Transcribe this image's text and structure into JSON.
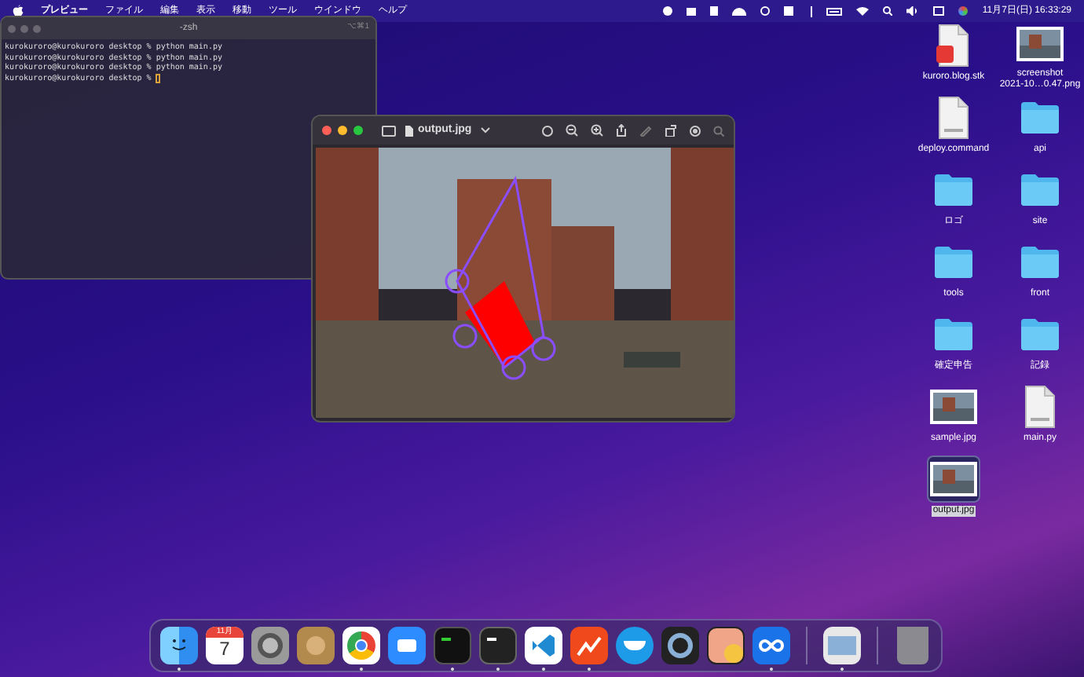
{
  "menu_bar": {
    "app_name": "プレビュー",
    "menus": [
      "ファイル",
      "編集",
      "表示",
      "移動",
      "ツール",
      "ウインドウ",
      "ヘルプ"
    ],
    "clock": "11月7日(日) 16:33:29"
  },
  "terminal": {
    "title": "-zsh",
    "shortcut": "⌥⌘1",
    "lines": [
      "kurokuroro@kurokuroro desktop % python main.py",
      "kurokuroro@kurokuroro desktop % python main.py",
      "kurokuroro@kurokuroro desktop % python main.py",
      "kurokuroro@kurokuroro desktop % "
    ]
  },
  "preview": {
    "title": "output.jpg"
  },
  "desktop_icons": [
    {
      "kind": "document",
      "label": "kuroro.blog.stk",
      "selected": false
    },
    {
      "kind": "image",
      "label": "screenshot\n2021-10…0.47.png",
      "selected": false
    },
    {
      "kind": "script",
      "label": "deploy.command",
      "selected": false
    },
    {
      "kind": "folder",
      "label": "api",
      "selected": false
    },
    {
      "kind": "folder",
      "label": "ロゴ",
      "selected": false
    },
    {
      "kind": "folder",
      "label": "site",
      "selected": false
    },
    {
      "kind": "folder",
      "label": "tools",
      "selected": false
    },
    {
      "kind": "folder",
      "label": "front",
      "selected": false
    },
    {
      "kind": "folder",
      "label": "確定申告",
      "selected": false
    },
    {
      "kind": "folder",
      "label": "記録",
      "selected": false
    },
    {
      "kind": "image",
      "label": "sample.jpg",
      "selected": false
    },
    {
      "kind": "script",
      "label": "main.py",
      "selected": false
    },
    {
      "kind": "image",
      "label": "output.jpg",
      "selected": true
    }
  ],
  "dock": {
    "apps": [
      {
        "kind": "finder",
        "running": true
      },
      {
        "kind": "calendar",
        "month": "11月",
        "day": "7",
        "running": false
      },
      {
        "kind": "settings",
        "running": false
      },
      {
        "kind": "contacts",
        "running": false
      },
      {
        "kind": "chrome",
        "running": true
      },
      {
        "kind": "zoom",
        "running": false
      },
      {
        "kind": "iterm",
        "running": true
      },
      {
        "kind": "terminal",
        "running": true
      },
      {
        "kind": "vscode",
        "running": true
      },
      {
        "kind": "chart",
        "running": true
      },
      {
        "kind": "docker",
        "running": false
      },
      {
        "kind": "quicktime",
        "running": false
      },
      {
        "kind": "amphetamine",
        "running": false
      },
      {
        "kind": "infinity",
        "running": true
      }
    ],
    "extras": [
      {
        "kind": "preview",
        "running": true
      },
      {
        "kind": "trash",
        "running": false
      }
    ]
  }
}
